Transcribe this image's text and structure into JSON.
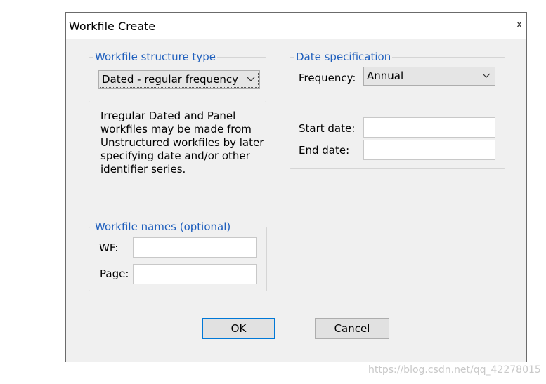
{
  "dialog": {
    "title": "Workfile Create",
    "close_glyph": "x"
  },
  "structure_group": {
    "legend": "Workfile structure type",
    "selected": "Dated - regular frequency",
    "description": "Irregular Dated and Panel workfiles may be made from Unstructured workfiles by later specifying date and/or other identifier series."
  },
  "date_group": {
    "legend": "Date specification",
    "frequency_label": "Frequency:",
    "frequency_value": "Annual",
    "start_label": "Start date:",
    "start_value": "",
    "end_label": "End date:",
    "end_value": ""
  },
  "names_group": {
    "legend": "Workfile names (optional)",
    "wf_label": "WF:",
    "wf_value": "",
    "page_label": "Page:",
    "page_value": ""
  },
  "buttons": {
    "ok": "OK",
    "cancel": "Cancel"
  },
  "watermark": "https://blog.csdn.net/qq_42278015"
}
